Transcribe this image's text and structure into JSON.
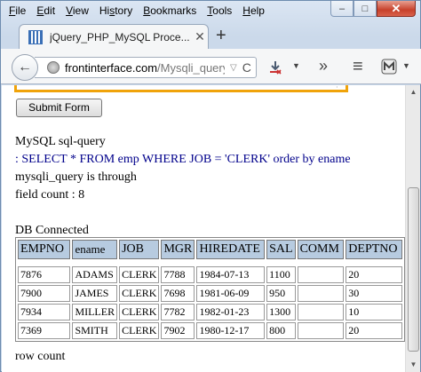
{
  "menu": [
    {
      "label": "File",
      "key": "F",
      "rest": "ile"
    },
    {
      "label": "Edit",
      "key": "E",
      "rest": "dit"
    },
    {
      "label": "View",
      "key": "V",
      "rest": "iew"
    },
    {
      "label": "History",
      "key": "s",
      "pre": "Hi",
      "rest": "tory"
    },
    {
      "label": "Bookmarks",
      "key": "B",
      "rest": "ookmarks"
    },
    {
      "label": "Tools",
      "key": "T",
      "rest": "ools"
    },
    {
      "label": "Help",
      "key": "H",
      "rest": "elp"
    }
  ],
  "window_controls": {
    "minimize": "–",
    "maximize": "□",
    "close": "✕"
  },
  "tab": {
    "title": "jQuery_PHP_MySQL Proce...",
    "close": "✕",
    "new_tab": "+"
  },
  "nav": {
    "back": "←",
    "url_host": "frontinterface.com",
    "url_path": "/Mysqli_query_",
    "url_dropdown": "▽",
    "reload": "C",
    "icons": {
      "downloads": "download-icon",
      "overflow": "»",
      "menu": "≡",
      "addon": "addon-icon"
    }
  },
  "page": {
    "submit_label": "Submit Form",
    "line_heading": "MySQL sql-query",
    "line_query": ": SELECT * FROM emp WHERE JOB = 'CLERK' order by ename",
    "line_through": "mysqli_query is through",
    "line_field_count": "field count : 8",
    "line_db": "DB Connected",
    "line_row_count": "row count",
    "table": {
      "headers": [
        "EMPNO",
        "ename",
        "JOB",
        "MGR",
        "HIREDATE",
        "SAL",
        "COMM",
        "DEPTNO"
      ],
      "rows": [
        [
          "7876",
          "ADAMS",
          "CLERK",
          "7788",
          "1984-07-13",
          "1100",
          "",
          "20"
        ],
        [
          "7900",
          "JAMES",
          "CLERK",
          "7698",
          "1981-06-09",
          "950",
          "",
          "30"
        ],
        [
          "7934",
          "MILLER",
          "CLERK",
          "7782",
          "1982-01-23",
          "1300",
          "",
          "10"
        ],
        [
          "7369",
          "SMITH",
          "CLERK",
          "7902",
          "1980-12-17",
          "800",
          "",
          "20"
        ]
      ]
    }
  },
  "colors": {
    "accent_query": "#00008b",
    "header_bg": "#b7cbe0",
    "textarea_border": "#f0a30a"
  }
}
